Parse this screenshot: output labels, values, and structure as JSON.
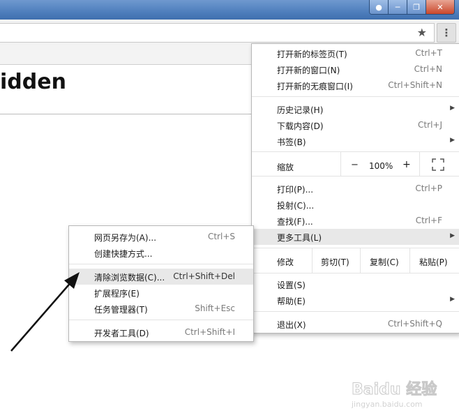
{
  "page": {
    "heading": "idden"
  },
  "menu": {
    "items": [
      {
        "label": "打开新的标签页(T)",
        "shortcut": "Ctrl+T"
      },
      {
        "label": "打开新的窗口(N)",
        "shortcut": "Ctrl+N"
      },
      {
        "label": "打开新的无痕窗口(I)",
        "shortcut": "Ctrl+Shift+N"
      },
      {
        "label": "历史记录(H)",
        "shortcut": ""
      },
      {
        "label": "下载内容(D)",
        "shortcut": "Ctrl+J"
      },
      {
        "label": "书签(B)",
        "shortcut": ""
      },
      {
        "label": "打印(P)...",
        "shortcut": "Ctrl+P"
      },
      {
        "label": "投射(C)...",
        "shortcut": ""
      },
      {
        "label": "查找(F)...",
        "shortcut": "Ctrl+F"
      },
      {
        "label": "更多工具(L)",
        "shortcut": ""
      },
      {
        "label": "设置(S)",
        "shortcut": ""
      },
      {
        "label": "帮助(E)",
        "shortcut": ""
      },
      {
        "label": "退出(X)",
        "shortcut": "Ctrl+Shift+Q"
      }
    ],
    "zoom": {
      "label": "缩放",
      "minus": "−",
      "value": "100%",
      "plus": "+"
    },
    "edit": {
      "label": "修改",
      "cut": "剪切(T)",
      "copy": "复制(C)",
      "paste": "粘贴(P)"
    }
  },
  "submenu": {
    "items": [
      {
        "label": "网页另存为(A)...",
        "shortcut": "Ctrl+S"
      },
      {
        "label": "创建快捷方式...",
        "shortcut": ""
      },
      {
        "label": "清除浏览数据(C)...",
        "shortcut": "Ctrl+Shift+Del"
      },
      {
        "label": "扩展程序(E)",
        "shortcut": ""
      },
      {
        "label": "任务管理器(T)",
        "shortcut": "Shift+Esc"
      },
      {
        "label": "开发者工具(D)",
        "shortcut": "Ctrl+Shift+I"
      }
    ]
  },
  "watermark": {
    "brand": "Baidu 经验",
    "url": "jingyan.baidu.com"
  },
  "icons": {
    "star": "★",
    "menu": "⋮",
    "arrow": "▶"
  }
}
